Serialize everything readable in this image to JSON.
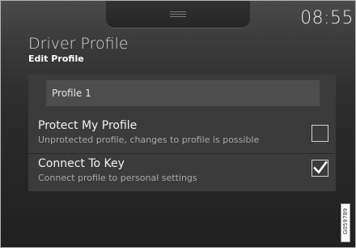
{
  "status": {
    "time": "08:55"
  },
  "header": {
    "title": "Driver Profile",
    "subtitle": "Edit Profile"
  },
  "profile_name": {
    "value": "Profile 1"
  },
  "settings": [
    {
      "title": "Protect My Profile",
      "subtitle": "Unprotected profile, changes to profile is possible",
      "checked": false
    },
    {
      "title": "Connect To Key",
      "subtitle": "Connect profile to personal settings",
      "checked": true
    }
  ],
  "image_code": "G059789",
  "colors": {
    "background": "#2b2b2b",
    "panel": "#3b3b3b",
    "field": "#4d4d4d",
    "text": "#f2f2f2",
    "muted": "#a8a8a8"
  }
}
